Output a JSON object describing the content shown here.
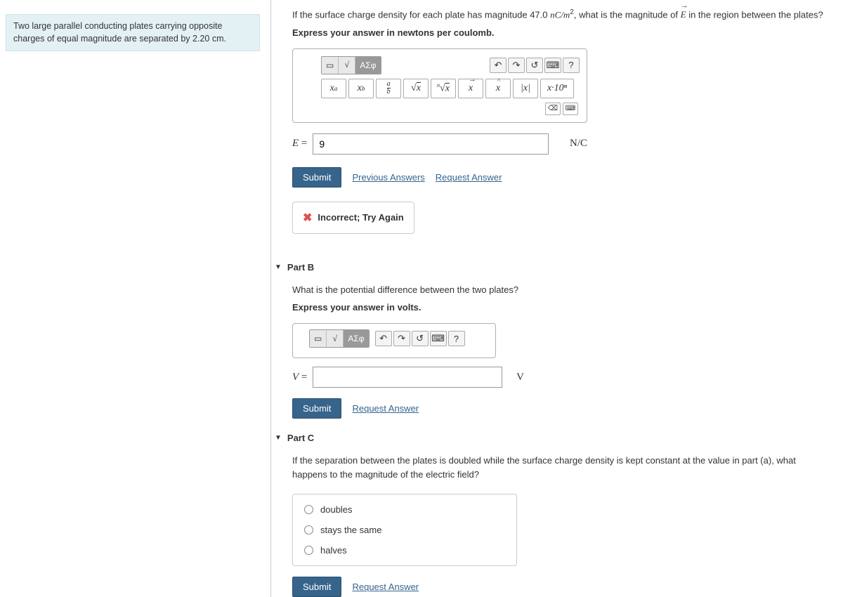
{
  "left": {
    "statement": "Two large parallel conducting plates carrying opposite charges of equal magnitude are separated by 2.20 cm."
  },
  "partA": {
    "question_prefix": "If the surface charge density for each plate has magnitude 47.0 ",
    "question_units": "nC/m",
    "question_exp": "2",
    "question_mid": ", what is the magnitude of ",
    "question_vec": "E",
    "question_suffix": " in the region between the plates?",
    "instruction": "Express your answer in newtons per coulomb.",
    "toolbar": {
      "greek": "ΑΣφ",
      "sup": "xᵃ",
      "sub": "xᵦ",
      "frac": "a/b",
      "sqrt": "√x",
      "nroot": "ⁿ√x",
      "xvec": "x",
      "xhat": "x",
      "abs": "|x|",
      "sci": "x·10ⁿ",
      "help": "?"
    },
    "label": "E",
    "equals": " = ",
    "value": "9",
    "unit": "N/C",
    "submit": "Submit",
    "prev_answers": "Previous Answers",
    "request": "Request Answer",
    "feedback": "Incorrect; Try Again"
  },
  "partB": {
    "title": "Part B",
    "question": "What is the potential difference between the two plates?",
    "instruction": "Express your answer in volts.",
    "toolbar": {
      "greek": "ΑΣφ",
      "help": "?"
    },
    "label": "V",
    "equals": " = ",
    "value": "",
    "unit": "V",
    "submit": "Submit",
    "request": "Request Answer"
  },
  "partC": {
    "title": "Part C",
    "question": "If the separation between the plates is doubled while the surface charge density is kept constant at the value in part (a), what happens to the magnitude of the electric field?",
    "options": [
      "doubles",
      "stays the same",
      "halves"
    ],
    "submit": "Submit",
    "request": "Request Answer"
  }
}
